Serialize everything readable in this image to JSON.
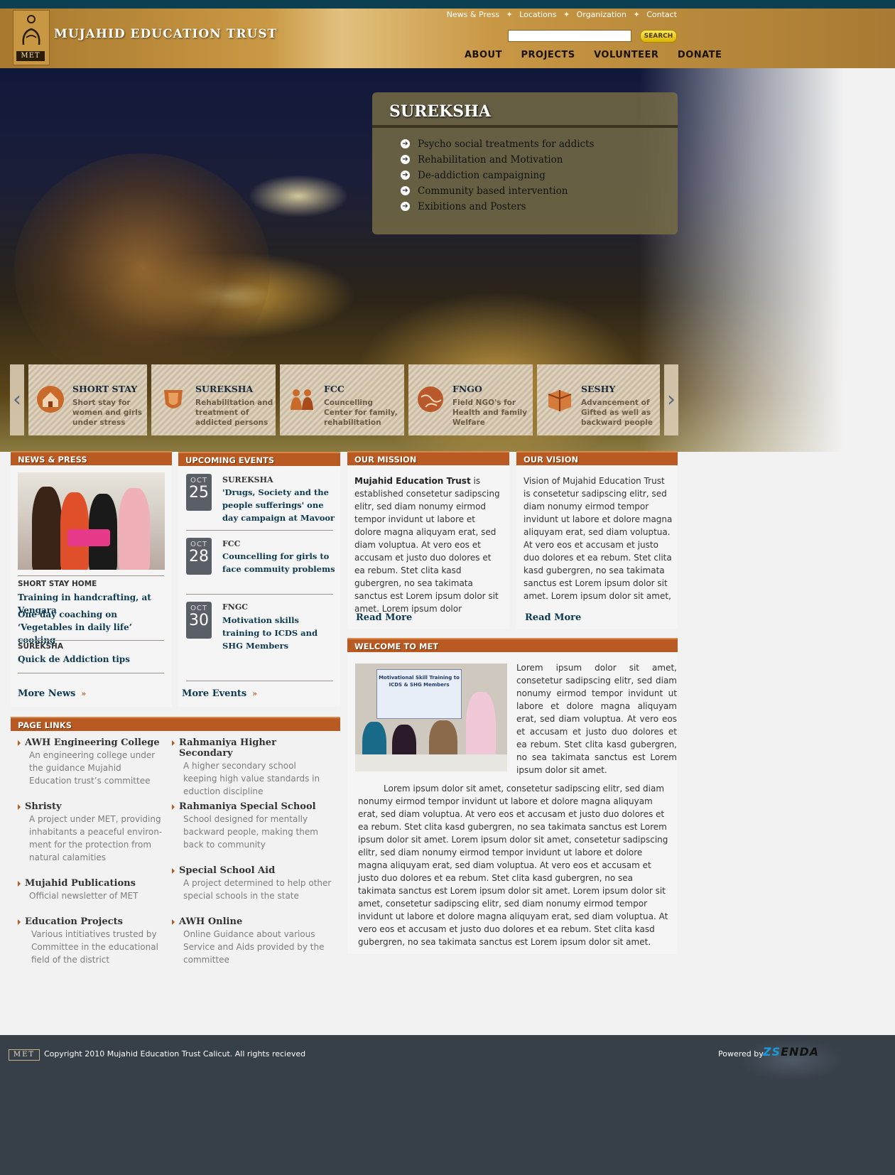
{
  "header": {
    "logo_text": "MET",
    "site_title": "MUJAHID EDUCATION TRUST",
    "top_links": [
      "News & Press",
      "Locations",
      "Organization",
      "Contact"
    ],
    "search_button": "SEARCH",
    "nav": [
      "ABOUT",
      "PROJECTS",
      "VOLUNTEER",
      "DONATE"
    ]
  },
  "hero": {
    "panel_title": "SUREKSHA",
    "bullets": [
      "Psycho social treatments for addicts",
      "Rehabilitation and Motivation",
      "De-addiction campaigning",
      "Community based intervention",
      "Exibitions and Posters"
    ]
  },
  "programs": [
    {
      "title": "SHORT STAY",
      "desc": "Short stay for women and girls under stress",
      "icon": "house-icon"
    },
    {
      "title": "SUREKSHA",
      "desc": "Rehabilitation and treatment of addicted persons",
      "icon": "shield-icon"
    },
    {
      "title": "FCC",
      "desc": "Councelling Center for family, rehabilitation",
      "icon": "family-icon"
    },
    {
      "title": "FNGO",
      "desc": "Field NGO's for Health and family Welfare",
      "icon": "globe-icon"
    },
    {
      "title": "SESHY",
      "desc": "Advancement of Gifted  as well as backward people",
      "icon": "gift-icon"
    }
  ],
  "news": {
    "header": "NEWS & PRESS",
    "items": [
      {
        "label": "SHORT STAY HOME",
        "link": "Training in handcrafting, at Vengara"
      },
      {
        "label": "",
        "link": "One day coaching on ‘Vegetables in daily life’ cooking"
      },
      {
        "label": "SUREKSHA",
        "link": "Quick de Addiction tips"
      }
    ],
    "more": "More News"
  },
  "events": {
    "header": "UPCOMING EVENTS",
    "items": [
      {
        "month": "OCT",
        "day": "25",
        "category": "SUREKSHA",
        "title": "'Drugs, Society and the people sufferings' one day campaign at Mavoor"
      },
      {
        "month": "OCT",
        "day": "28",
        "category": "FCC",
        "title": "Councelling for girls to face commuity problems"
      },
      {
        "month": "OCT",
        "day": "30",
        "category": "FNGC",
        "title": "Motivation skills training to ICDS and SHG Members"
      }
    ],
    "more": "More Events"
  },
  "mission": {
    "header": "OUR MISSION",
    "lead": "Mujahid Education Trust",
    "text": " is established  consetetur sadipscing elitr, sed diam nonumy eirmod tempor invidunt ut labore et dolore magna aliquyam erat, sed diam voluptua. At vero eos et accusam et justo duo dolores et ea rebum. Stet clita kasd gubergren, no sea takimata sanctus est Lorem ipsum dolor sit amet. Lorem ipsum dolor",
    "read_more": "Read More"
  },
  "vision": {
    "header": "OUR VISION",
    "text": "Vision of Mujahid Education Trust is consetetur sadipscing elitr, sed diam nonumy eirmod tempor invidunt ut labore et dolore magna aliquyam erat, sed diam voluptua. At vero eos et accusam et justo duo dolores et ea rebum. Stet clita kasd gubergren, no sea takimata sanctus est Lorem ipsum dolor sit amet. Lorem ipsum dolor sit amet,",
    "read_more": "Read More"
  },
  "welcome": {
    "header": "WELCOME TO MET",
    "banner_text": "Motivational Skill Training to ICDS & SHG Members",
    "side_text": "Lorem ipsum dolor sit amet, consetetur sadipscing elitr, sed diam nonumy eirmod tempor invidunt ut labore et dolore magna aliquyam erat, sed diam voluptua. At vero eos et accusam et justo duo dolores et ea rebum. Stet clita kasd gubergren, no sea takimata sanctus est Lorem ipsum dolor sit amet.",
    "body_text": "Lorem ipsum dolor sit amet, consetetur sadipscing elitr, sed diam nonumy eirmod tempor invidunt ut labore et dolore magna aliquyam erat, sed diam voluptua. At vero eos et accusam et justo duo dolores et ea rebum. Stet clita kasd gubergren, no sea takimata sanctus est Lorem ipsum dolor sit amet. Lorem ipsum dolor sit amet, consetetur sadipscing elitr,  sed diam nonumy eirmod tempor invidunt ut labore et dolore magna aliquyam erat, sed diam voluptua. At vero eos et accusam et justo duo dolores et ea rebum. Stet clita kasd gubergren, no sea takimata sanctus est Lorem ipsum dolor sit amet. Lorem ipsum dolor sit amet, consetetur sadipscing elitr,  sed diam nonumy eirmod tempor invidunt ut labore et dolore magna aliquyam erat, sed diam voluptua. At vero eos et accusam et justo duo dolores et ea rebum. Stet clita kasd gubergren, no sea takimata sanctus est Lorem ipsum dolor sit amet."
  },
  "page_links": {
    "header": "PAGE LINKS",
    "left": [
      {
        "title": "AWH Engineering College",
        "desc": "An engineering college under the guidance Mujahid Education trust’s committee"
      },
      {
        "title": "Shristy",
        "desc": "A project under MET, providing inhabitants a peaceful environ-ment for the protection from natural calamities"
      },
      {
        "title": "Mujahid Publications",
        "desc": "Official newsletter of MET"
      },
      {
        "title": "Education Projects",
        "desc": "Various intitiatives trusted by Committee in the educational field of the district"
      }
    ],
    "right": [
      {
        "title": "Rahmaniya Higher Secondary",
        "desc": "A higher secondary school keeping high value standards in eduction discipline"
      },
      {
        "title": "Rahmaniya Special School",
        "desc": "School designed for mentally backward people, making them back to community"
      },
      {
        "title": "Special School Aid",
        "desc": "A project determined to help other special schools in the state"
      },
      {
        "title": "AWH Online",
        "desc": "Online Guidance about various Service  and Aids provided by the committee"
      }
    ]
  },
  "footer": {
    "logo_text": "MET",
    "copyright": "Copyright 2010 Mujahid Education Trust Calicut. All rights recieved",
    "powered_by": "Powered by",
    "brand_a": "ZS",
    "brand_b": "ENDA"
  }
}
